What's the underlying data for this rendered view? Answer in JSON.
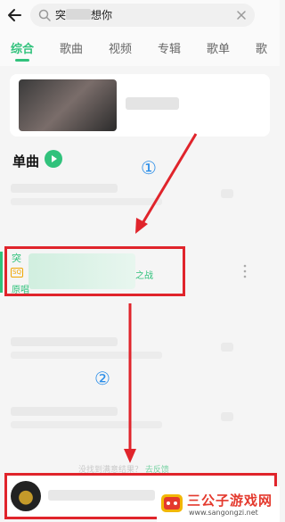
{
  "search": {
    "query_start": "突",
    "query_end": "想你"
  },
  "tabs": [
    "综合",
    "歌曲",
    "视频",
    "专辑",
    "歌单",
    "歌"
  ],
  "songs_section": {
    "title": "单曲"
  },
  "song": {
    "title": "突",
    "badge": "SQ",
    "album_suffix": "之战",
    "origin_label": "原唱"
  },
  "annotations": {
    "step1": "①",
    "step2": "②"
  },
  "hint": {
    "text": "没找到满意结果？",
    "link": "去反馈"
  },
  "watermark": {
    "name": "三公子游戏网",
    "url": "www.sangongzi.net"
  },
  "colors": {
    "accent": "#31c27c",
    "annotation_red": "#e0242b",
    "annotation_blue": "#2a8de8"
  }
}
